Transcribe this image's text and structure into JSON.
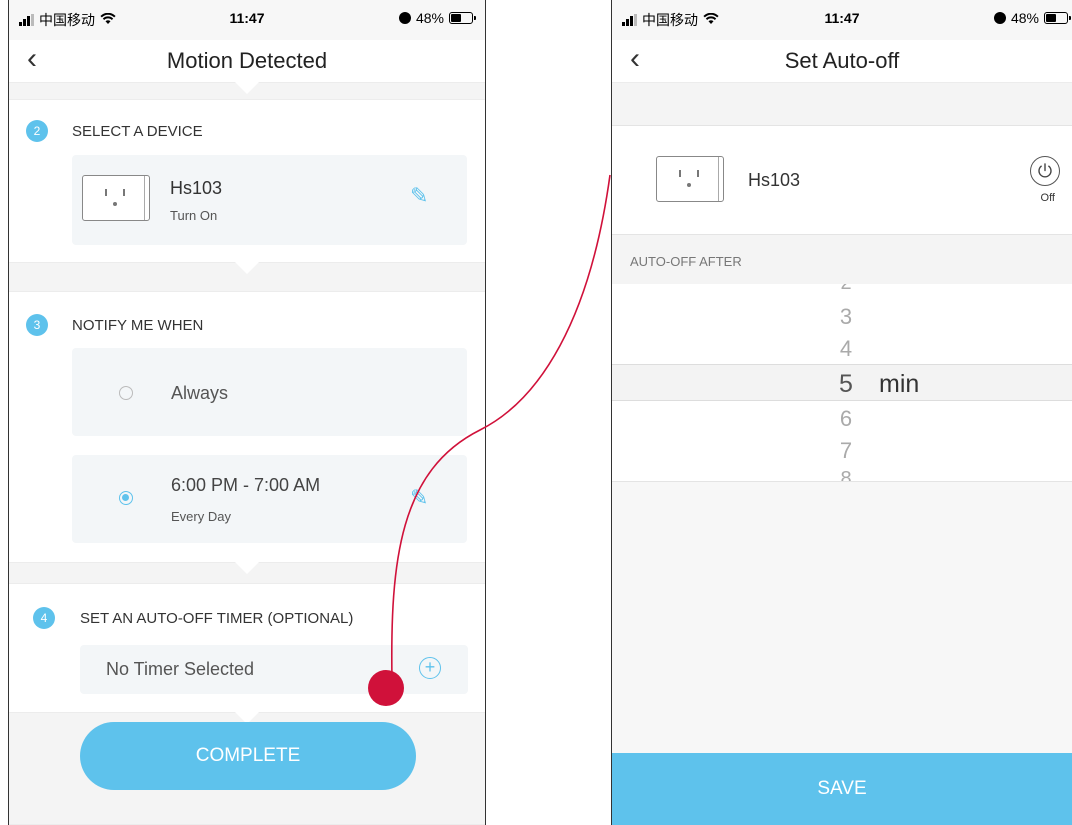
{
  "status": {
    "carrier": "中国移动",
    "time": "11:47",
    "battery": "48%"
  },
  "left": {
    "title": "Motion Detected",
    "step2": {
      "number": "2",
      "title": "SELECT A DEVICE"
    },
    "device": {
      "name": "Hs103",
      "action": "Turn On"
    },
    "step3": {
      "number": "3",
      "title": "NOTIFY ME WHEN"
    },
    "options": [
      {
        "label": "Always",
        "selected": false
      },
      {
        "label": "6:00 PM - 7:00 AM",
        "sub": "Every Day",
        "selected": true
      }
    ],
    "step4": {
      "number": "4",
      "title": "SET AN AUTO-OFF TIMER (OPTIONAL)"
    },
    "timer": {
      "value": "No Timer Selected"
    },
    "complete_label": "COMPLETE"
  },
  "right": {
    "title": "Set Auto-off",
    "device": {
      "name": "Hs103",
      "power_state": "Off"
    },
    "section_label": "AUTO-OFF AFTER",
    "picker": {
      "values": [
        "2",
        "3",
        "4",
        "5",
        "6",
        "7",
        "8"
      ],
      "selected": "5",
      "unit": "min"
    },
    "save_label": "SAVE"
  },
  "colors": {
    "accent": "#5ec2ec",
    "connector": "#d0113a"
  }
}
